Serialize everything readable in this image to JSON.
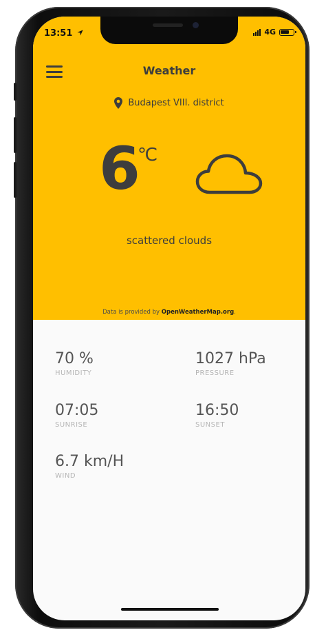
{
  "status_bar": {
    "time": "13:51",
    "network": "4G"
  },
  "header": {
    "title": "Weather"
  },
  "location": {
    "name": "Budapest VIII. district"
  },
  "current": {
    "temperature": "6",
    "unit": "℃",
    "condition_icon": "cloud-icon",
    "description": "scattered clouds"
  },
  "attribution": {
    "prefix": "Data is provided by ",
    "source": "OpenWeatherMap.org",
    "suffix": "."
  },
  "stats": {
    "humidity": {
      "value": "70 %",
      "label": "HUMIDITY"
    },
    "pressure": {
      "value": "1027 hPa",
      "label": "PRESSURE"
    },
    "sunrise": {
      "value": "07:05",
      "label": "SUNRISE"
    },
    "sunset": {
      "value": "16:50",
      "label": "SUNSET"
    },
    "wind": {
      "value": "6.7 km/H",
      "label": "WIND"
    }
  },
  "colors": {
    "accent": "#ffbf00",
    "text_dark": "#3d3d3d",
    "label_gray": "#b5b5b5",
    "background": "#fafafa"
  }
}
